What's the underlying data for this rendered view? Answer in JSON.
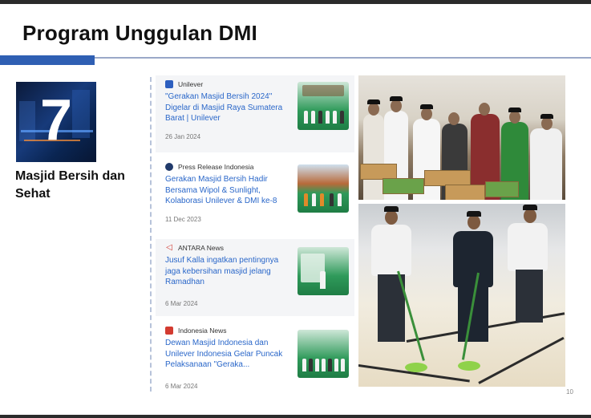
{
  "slide": {
    "title": "Program Unggulan DMI",
    "tile_number": "7",
    "caption": "Masjid Bersih dan Sehat",
    "page_number": "10"
  },
  "news": [
    {
      "source": "Unilever",
      "source_icon": "unilever-logo-icon",
      "headline": "\"Gerakan Masjid Bersih 2024\" Digelar di Masjid Raya Sumatera Barat | Unilever",
      "date": "26 Jan 2024"
    },
    {
      "source": "Press Release Indonesia",
      "source_icon": "press-release-logo-icon",
      "headline": "Gerakan Masjid Bersih Hadir Bersama Wipol & Sunlight, Kolaborasi Unilever & DMI ke-8",
      "date": "11 Dec 2023"
    },
    {
      "source": "ANTARA News",
      "source_icon": "antara-logo-icon",
      "headline": "Jusuf Kalla ingatkan pentingnya jaga kebersihan masjid jelang Ramadhan",
      "date": "6 Mar 2024"
    },
    {
      "source": "Indonesia News",
      "source_icon": "indonesia-news-logo-icon",
      "headline": "Dewan Masjid Indonesia dan Unilever Indonesia Gelar Puncak Pelaksanaan \"Geraka...",
      "date": "6 Mar 2024"
    }
  ],
  "colors": {
    "accent": "#2f5fb3",
    "link": "#2a67c9",
    "green": "#2f9a5a"
  }
}
